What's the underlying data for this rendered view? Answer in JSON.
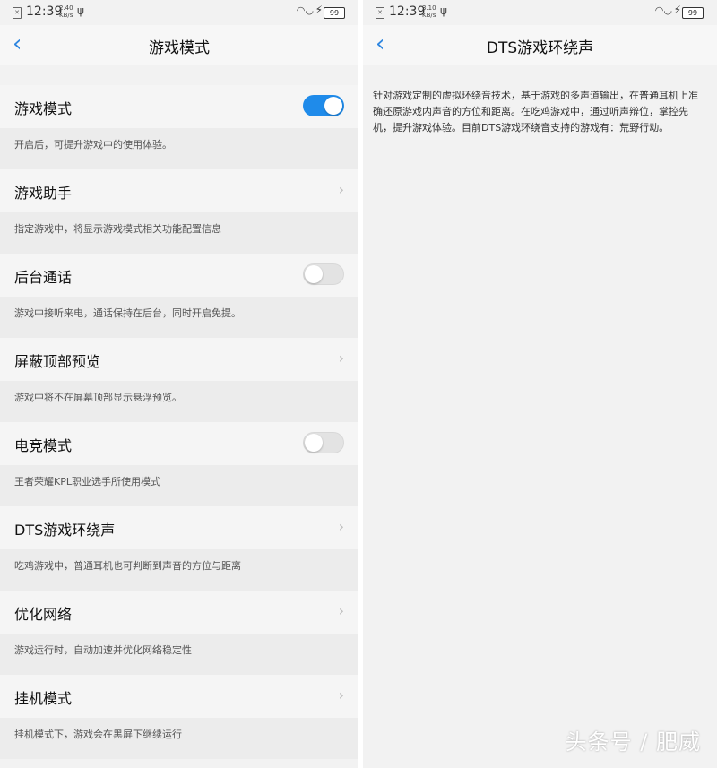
{
  "left": {
    "status": {
      "time": "12:39",
      "speed_top": "2.40",
      "speed_unit": "KB/s",
      "battery": "99"
    },
    "title": "游戏模式",
    "items": [
      {
        "label": "游戏模式",
        "control": "toggle",
        "state": "on",
        "desc": "开启后，可提升游戏中的使用体验。"
      },
      {
        "label": "游戏助手",
        "control": "chevron",
        "desc": "指定游戏中，将显示游戏模式相关功能配置信息"
      },
      {
        "label": "后台通话",
        "control": "toggle",
        "state": "off",
        "desc": "游戏中接听来电，通话保持在后台，同时开启免提。"
      },
      {
        "label": "屏蔽顶部预览",
        "control": "chevron",
        "desc": "游戏中将不在屏幕顶部显示悬浮预览。"
      },
      {
        "label": "电竞模式",
        "control": "toggle",
        "state": "off",
        "desc": "王者荣耀KPL职业选手所使用模式"
      },
      {
        "label": "DTS游戏环绕声",
        "control": "chevron",
        "desc": "吃鸡游戏中，普通耳机也可判断到声音的方位与距离"
      },
      {
        "label": "优化网络",
        "control": "chevron",
        "desc": "游戏运行时，自动加速并优化网络稳定性"
      },
      {
        "label": "挂机模式",
        "control": "chevron",
        "desc": "挂机模式下，游戏会在黑屏下继续运行"
      }
    ]
  },
  "right": {
    "status": {
      "time": "12:39",
      "speed_top": "3.10",
      "speed_unit": "KB/s",
      "battery": "99"
    },
    "title": "DTS游戏环绕声",
    "description": "针对游戏定制的虚拟环绕音技术，基于游戏的多声道输出，在普通耳机上准确还原游戏内声音的方位和距离。在吃鸡游戏中，通过听声辩位，掌控先机，提升游戏体验。目前DTS游戏环绕音支持的游戏有：荒野行动。"
  },
  "watermark": "头条号 / 肥威",
  "colors": {
    "accent": "#1f8bea",
    "back_arrow": "#2e86e0",
    "background": "#f2f2f2"
  },
  "icons": {
    "back": "chevron-left-icon",
    "chevron": "chevron-right-icon",
    "wifi": "wifi-icon",
    "charging": "bolt-icon",
    "usb": "usb-icon"
  }
}
